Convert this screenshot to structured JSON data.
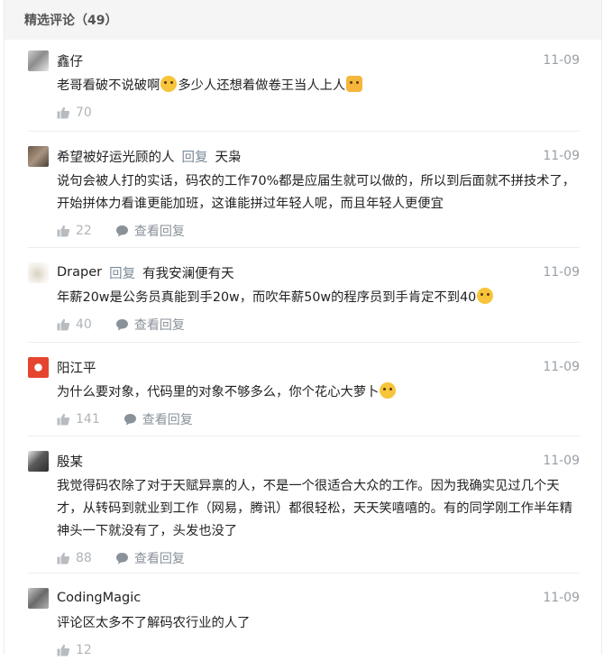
{
  "header": {
    "title": "精选评论（49）"
  },
  "comments": [
    {
      "author": "鑫仔",
      "reply_word": "",
      "reply_target": "",
      "date": "11-09",
      "text_parts": [
        "老哥看破不说破啊",
        "多少人还想着做卷王当人上人",
        ""
      ],
      "emojis": [
        "laugh-cry-emoji",
        "cat-emoji"
      ],
      "likes": "70",
      "view_replies": ""
    },
    {
      "author": "希望被好运光顾的人",
      "reply_word": "回复",
      "reply_target": "天枭",
      "date": "11-09",
      "text_parts": [
        "说句会被人打的实话，码农的工作70%都是应届生就可以做的，所以到后面就不拼技术了，开始拼体力看谁更能加班，这谁能拼过年轻人呢，而且年轻人更便宜"
      ],
      "likes": "22",
      "view_replies": "查看回复"
    },
    {
      "author": "Draper",
      "reply_word": "回复",
      "reply_target": "有我安澜便有天",
      "date": "11-09",
      "text_parts": [
        "年薪20w是公务员真能到手20w，而吹年薪50w的程序员到手肯定不到40"
      ],
      "emojis": [
        "relieved-emoji"
      ],
      "likes": "40",
      "view_replies": "查看回复"
    },
    {
      "author": "阳江平",
      "reply_word": "",
      "reply_target": "",
      "date": "11-09",
      "text_parts": [
        "为什么要对象，代码里的对象不够多么，你个花心大萝卜"
      ],
      "emojis": [
        "rofl-emoji"
      ],
      "likes": "141",
      "view_replies": "查看回复"
    },
    {
      "author": "殷某",
      "reply_word": "",
      "reply_target": "",
      "date": "11-09",
      "text_parts": [
        "我觉得码农除了对于天赋异禀的人，不是一个很适合大众的工作。因为我确实见过几个天才，从转码到就业到工作（网易，腾讯）都很轻松，天天笑嘻嘻的。有的同学刚工作半年精神头一下就没有了，头发也没了"
      ],
      "likes": "88",
      "view_replies": "查看回复"
    },
    {
      "author": "CodingMagic",
      "reply_word": "",
      "reply_target": "",
      "date": "11-09",
      "text_parts": [
        "评论区太多不了解码农行业的人了"
      ],
      "likes": "12",
      "view_replies": ""
    }
  ],
  "colors": {
    "header_bg": "#f5f5f5",
    "reply_word": "#7a8a99",
    "date": "#9aa0a6",
    "action": "#b0b4b8"
  }
}
